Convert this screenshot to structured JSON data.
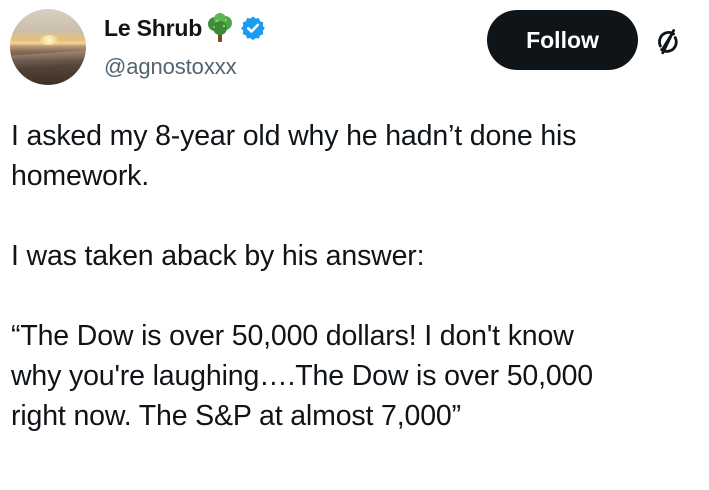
{
  "author": {
    "display_name": "Le Shrub",
    "name_emoji": "tree-icon",
    "verified": true,
    "verified_color": "#1d9bf0",
    "handle": "@agnostoxxx",
    "avatar": "sunset-beach-avatar"
  },
  "actions": {
    "follow_label": "Follow",
    "follow_bg": "#0f1419",
    "follow_text_color": "#ffffff",
    "grok_icon": "grok-icon"
  },
  "tweet": {
    "paragraphs": [
      "I asked my 8-year old why he hadn’t  done his\nhomework.",
      "I was taken aback by his answer:",
      "“The Dow is over 50,000 dollars! I don't know\nwhy you're laughing….The Dow is over 50,000\nright now. The S&P at almost 7,000”"
    ]
  },
  "colors": {
    "text_primary": "#0f1419",
    "text_secondary": "#536471",
    "background": "#ffffff"
  }
}
